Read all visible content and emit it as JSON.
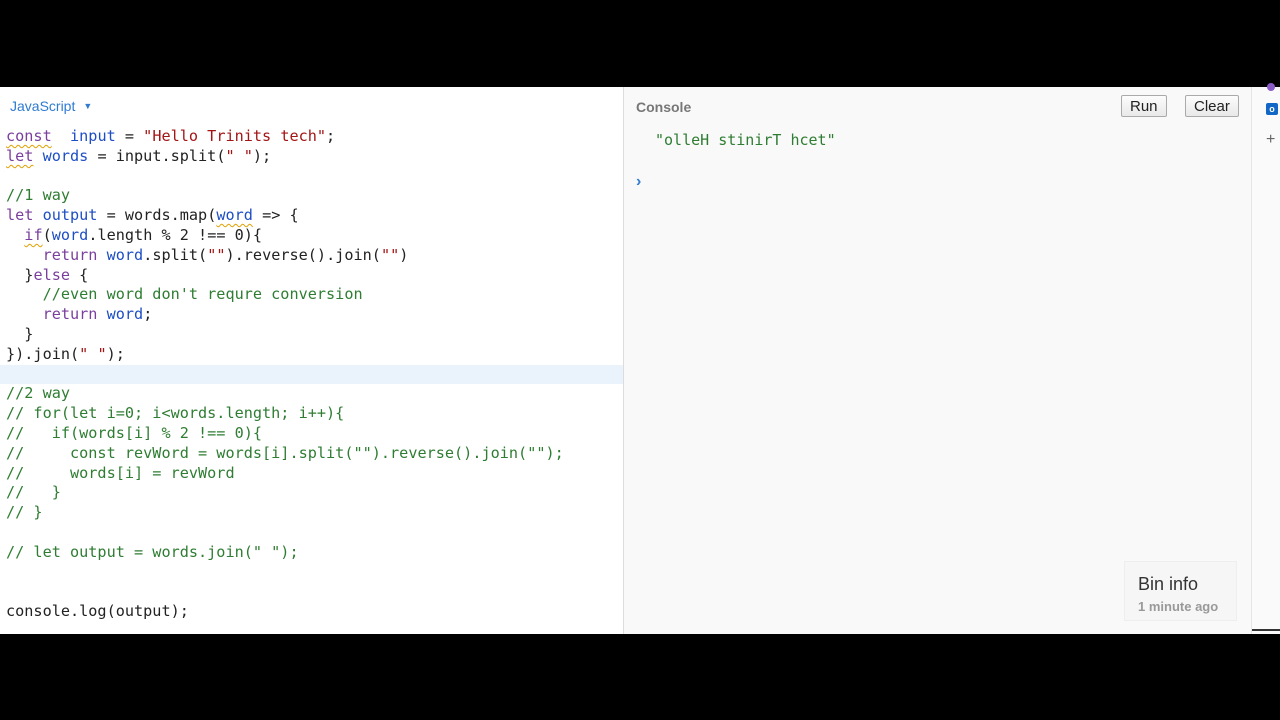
{
  "editor": {
    "language": "JavaScript",
    "lines": [
      {
        "t": "code",
        "parts": [
          [
            "kw",
            "const"
          ],
          [
            "",
            "  "
          ],
          [
            "vr",
            "input"
          ],
          [
            "",
            " = "
          ],
          [
            "st",
            "\"Hello Trinits tech\""
          ],
          [
            "",
            ";"
          ]
        ]
      },
      {
        "t": "code",
        "parts": [
          [
            "kw",
            "let"
          ],
          [
            "",
            " "
          ],
          [
            "vr",
            "words"
          ],
          [
            "",
            " = input.split("
          ],
          [
            "st",
            "\" \""
          ],
          [
            "",
            ");"
          ]
        ]
      },
      {
        "t": "blank"
      },
      {
        "t": "comment",
        "text": "//1 way"
      },
      {
        "t": "code",
        "parts": [
          [
            "kw",
            "let"
          ],
          [
            "",
            " "
          ],
          [
            "vr",
            "output"
          ],
          [
            "",
            " = words.map("
          ],
          [
            "vr",
            "word"
          ],
          [
            "",
            " => {"
          ]
        ]
      },
      {
        "t": "code",
        "parts": [
          [
            "",
            "  "
          ],
          [
            "kw",
            "if"
          ],
          [
            "",
            "("
          ],
          [
            "vr",
            "word"
          ],
          [
            "",
            ".length % 2 !== 0){"
          ]
        ]
      },
      {
        "t": "code",
        "parts": [
          [
            "",
            "    "
          ],
          [
            "kw",
            "return"
          ],
          [
            "",
            " "
          ],
          [
            "vr",
            "word"
          ],
          [
            "",
            ".split("
          ],
          [
            "st",
            "\"\""
          ],
          [
            "",
            ").reverse().join("
          ],
          [
            "st",
            "\"\""
          ],
          [
            "",
            ")"
          ]
        ]
      },
      {
        "t": "code",
        "parts": [
          [
            "",
            "  }"
          ],
          [
            "kw",
            "else"
          ],
          [
            "",
            " {"
          ]
        ]
      },
      {
        "t": "comment",
        "text": "    //even word don't requre conversion"
      },
      {
        "t": "code",
        "parts": [
          [
            "",
            "    "
          ],
          [
            "kw",
            "return"
          ],
          [
            "",
            " "
          ],
          [
            "vr",
            "word"
          ],
          [
            "",
            ";"
          ]
        ]
      },
      {
        "t": "code",
        "parts": [
          [
            "",
            "  }"
          ]
        ]
      },
      {
        "t": "code",
        "parts": [
          [
            "",
            "}).join("
          ],
          [
            "st",
            "\" \""
          ],
          [
            "",
            ");"
          ]
        ]
      },
      {
        "t": "blank",
        "active": true
      },
      {
        "t": "comment",
        "text": "//2 way"
      },
      {
        "t": "comment",
        "text": "// for(let i=0; i<words.length; i++){"
      },
      {
        "t": "comment",
        "text": "//   if(words[i] % 2 !== 0){"
      },
      {
        "t": "comment",
        "text": "//     const revWord = words[i].split(\"\").reverse().join(\"\");"
      },
      {
        "t": "comment",
        "text": "//     words[i] = revWord"
      },
      {
        "t": "comment",
        "text": "//   }"
      },
      {
        "t": "comment",
        "text": "// }"
      },
      {
        "t": "blank"
      },
      {
        "t": "comment",
        "text": "// let output = words.join(\" \");"
      },
      {
        "t": "blank"
      },
      {
        "t": "blank"
      },
      {
        "t": "code",
        "parts": [
          [
            "",
            "console.log(output);"
          ]
        ]
      }
    ]
  },
  "console": {
    "title": "Console",
    "run_label": "Run",
    "clear_label": "Clear",
    "output": "\"olleH stinirT hcet\"",
    "prompt_icon": "chevron-right-icon",
    "prompt_glyph": "›"
  },
  "bin_info": {
    "title": "Bin info",
    "time": "1 minute ago"
  },
  "colors": {
    "keyword": "#7a3e9d",
    "variable": "#1d4ec4",
    "string": "#a31515",
    "comment": "#2e7d32",
    "accent": "#2f7bd0"
  }
}
